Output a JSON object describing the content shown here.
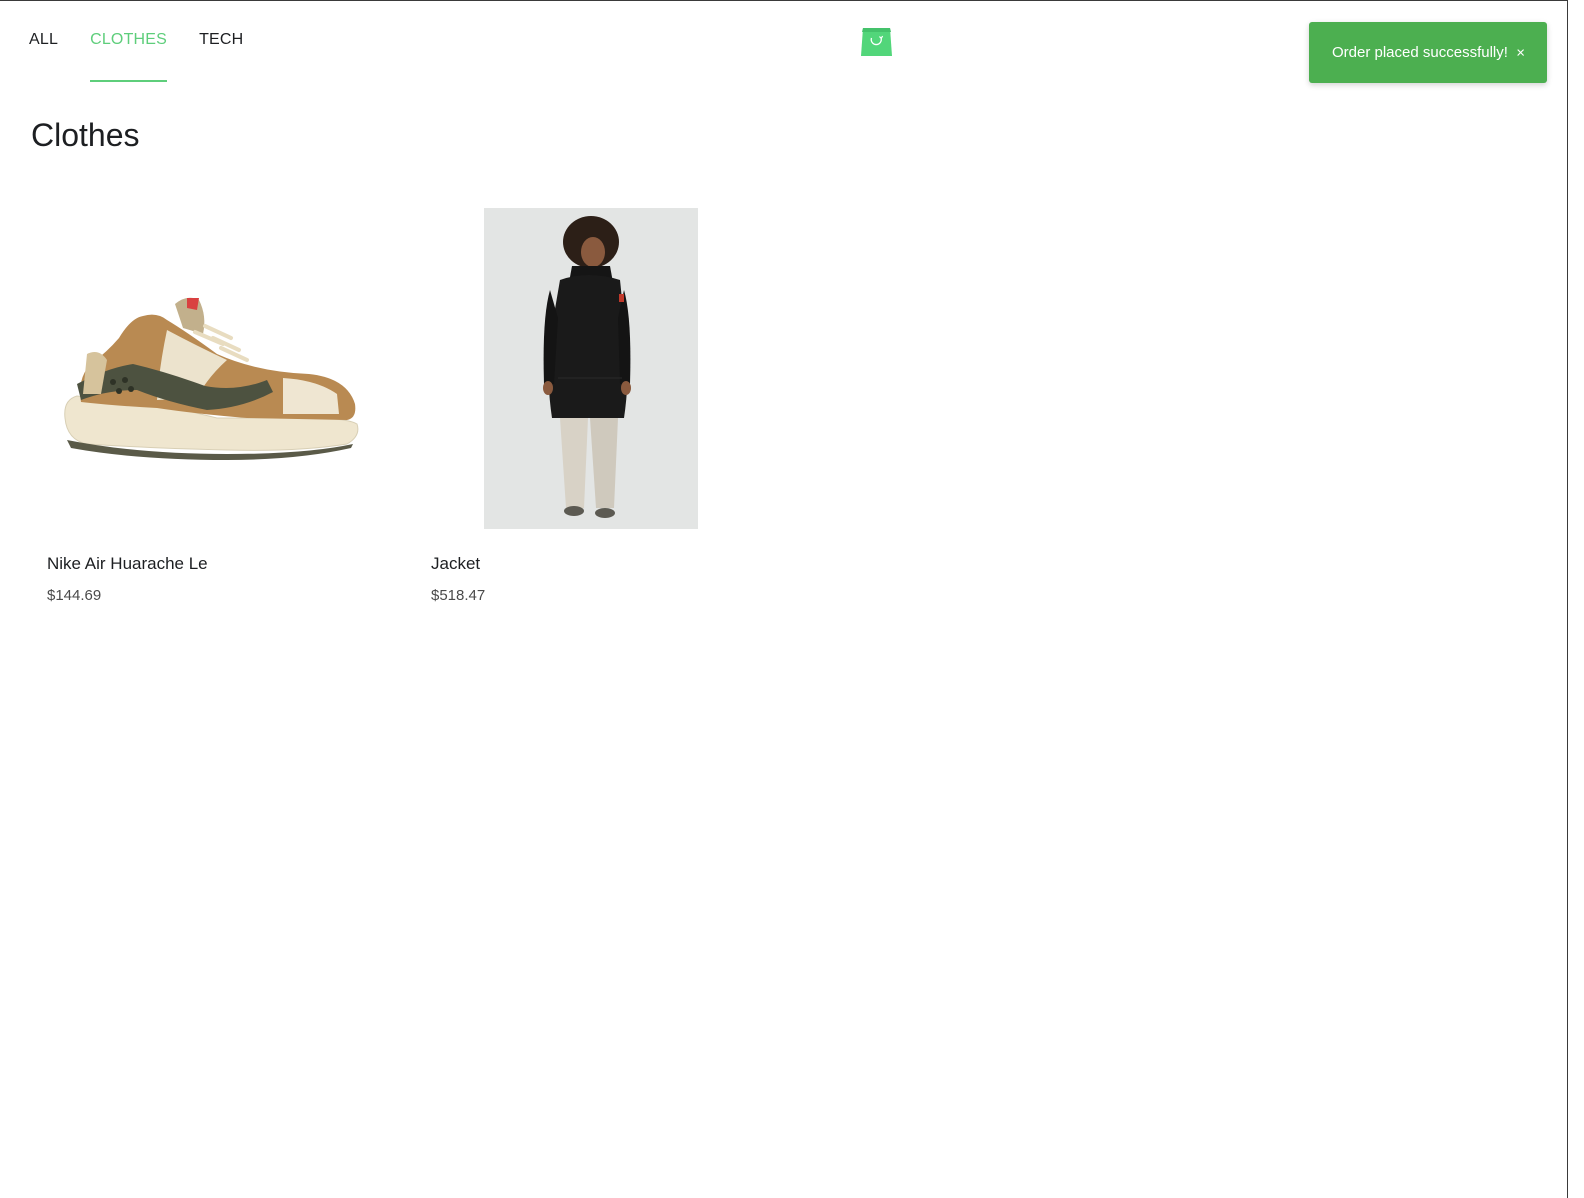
{
  "nav": {
    "tabs": [
      {
        "label": "ALL",
        "active": false
      },
      {
        "label": "CLOTHES",
        "active": true
      },
      {
        "label": "TECH",
        "active": false
      }
    ]
  },
  "header": {
    "logo_icon": "shopping-bag-icon"
  },
  "toast": {
    "message": "Order placed successfully!",
    "close_label": "×",
    "color": "#4caf50"
  },
  "page": {
    "title": "Clothes"
  },
  "products": [
    {
      "name": "Nike Air Huarache Le",
      "price": "$144.69",
      "image_icon": "sneaker-image"
    },
    {
      "name": "Jacket",
      "price": "$518.47",
      "image_icon": "jacket-image"
    }
  ],
  "colors": {
    "accent": "#5ece7b",
    "text": "#1d1f22"
  }
}
